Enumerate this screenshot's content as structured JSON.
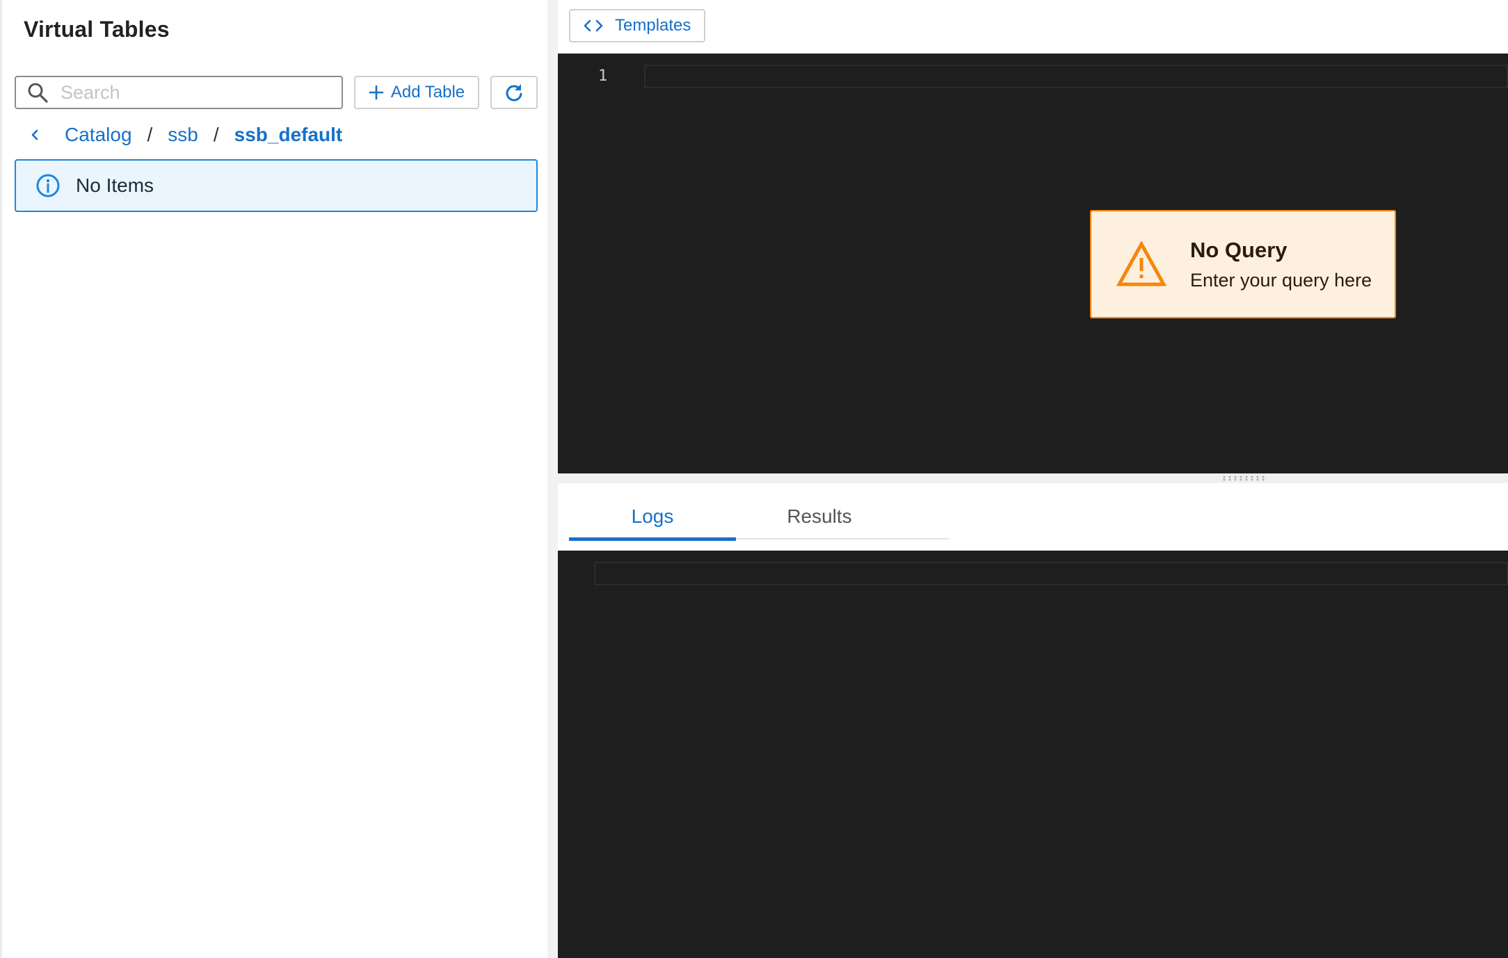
{
  "sidebar": {
    "title": "Virtual Tables",
    "search": {
      "placeholder": "Search",
      "value": ""
    },
    "add_table_label": "Add Table",
    "breadcrumb": {
      "items": [
        "Catalog",
        "ssb"
      ],
      "current": "ssb_default",
      "separator": "/"
    },
    "empty_message": "No Items"
  },
  "editor": {
    "templates_label": "Templates",
    "line_numbers": [
      "1"
    ],
    "warning": {
      "title": "No Query",
      "message": "Enter your query here"
    }
  },
  "output": {
    "tabs": [
      {
        "label": "Logs",
        "active": true
      },
      {
        "label": "Results",
        "active": false
      }
    ]
  },
  "colors": {
    "accent": "#1670c9",
    "info_border": "#1f86de",
    "info_bg": "#eaf5fd",
    "warning_border": "#f5860e",
    "warning_bg": "#fef0df",
    "editor_bg": "#1e1e1e"
  },
  "icons": [
    "search-icon",
    "plus-icon",
    "refresh-icon",
    "chevron-left-icon",
    "info-icon",
    "code-icon",
    "warning-icon"
  ]
}
